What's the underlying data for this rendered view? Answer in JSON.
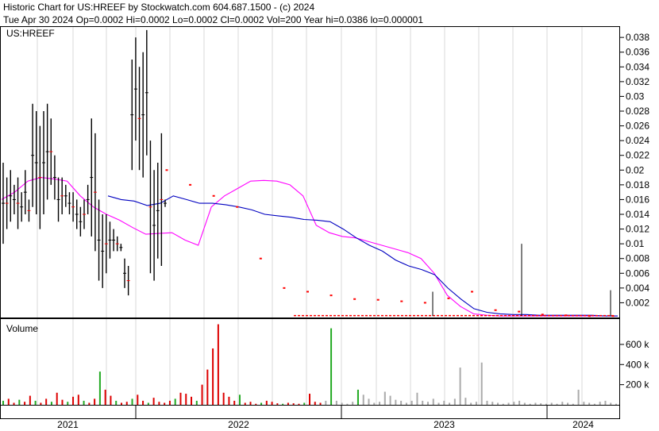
{
  "header": {
    "line1": "Historic Chart for US:HREEF by Stockwatch.com 604.687.1500 - (c) 2024",
    "line2": "Tue Apr 30 2024  Op=0.0002  Hi=0.0002  Lo=0.0002  Cl=0.0002  Vol=200  Year hi=0.0386  lo=0.000001"
  },
  "chart_data": [
    {
      "type": "line",
      "title": "US:HREEF",
      "ylim": [
        0,
        0.039
      ],
      "yticks": [
        "0.038",
        "0.036",
        "0.034",
        "0.032",
        "0.03",
        "0.028",
        "0.026",
        "0.024",
        "0.022",
        "0.02",
        "0.018",
        "0.016",
        "0.014",
        "0.012",
        "0.01",
        "0.008",
        "0.006",
        "0.004",
        "0.002"
      ],
      "xticks": [
        "2021",
        "2022",
        "2023",
        "2024"
      ],
      "grid": true,
      "colors": {
        "price": "#000000",
        "down_day": "#ff0000",
        "ma_short": "#ff00ff",
        "ma_long": "#0000c0"
      },
      "price_bars": [
        [
          0.01,
          0.021
        ],
        [
          0.012,
          0.019
        ],
        [
          0.013,
          0.02
        ],
        [
          0.014,
          0.018
        ],
        [
          0.012,
          0.019
        ],
        [
          0.013,
          0.017
        ],
        [
          0.014,
          0.02
        ],
        [
          0.013,
          0.016
        ],
        [
          0.015,
          0.029
        ],
        [
          0.014,
          0.028
        ],
        [
          0.012,
          0.026
        ],
        [
          0.014,
          0.028
        ],
        [
          0.016,
          0.029
        ],
        [
          0.018,
          0.027
        ],
        [
          0.016,
          0.022
        ],
        [
          0.013,
          0.019
        ],
        [
          0.014,
          0.019
        ],
        [
          0.015,
          0.018
        ],
        [
          0.014,
          0.017
        ],
        [
          0.013,
          0.017
        ],
        [
          0.012,
          0.016
        ],
        [
          0.011,
          0.015
        ],
        [
          0.012,
          0.016
        ],
        [
          0.014,
          0.018
        ],
        [
          0.011,
          0.027
        ],
        [
          0.009,
          0.025
        ],
        [
          0.005,
          0.016
        ],
        [
          0.004,
          0.014
        ],
        [
          0.006,
          0.014
        ],
        [
          0.008,
          0.013
        ],
        [
          0.009,
          0.012
        ],
        [
          0.009,
          0.011
        ],
        [
          0.009,
          0.01
        ],
        [
          0.004,
          0.008
        ],
        [
          0.003,
          0.007
        ],
        [
          0.02,
          0.035
        ],
        [
          0.024,
          0.038
        ],
        [
          0.02,
          0.034
        ],
        [
          0.019,
          0.036
        ],
        [
          0.022,
          0.039
        ],
        [
          0.006,
          0.024
        ],
        [
          0.005,
          0.02
        ],
        [
          0.008,
          0.021
        ],
        [
          0.007,
          0.025
        ],
        [
          0.015,
          0.016
        ]
      ],
      "dots": [
        [
          0.02
        ],
        [
          0.018
        ],
        [
          0.0165
        ],
        [
          0.015
        ],
        [
          0.008
        ],
        [
          0.004
        ],
        [
          0.0035
        ],
        [
          0.003
        ],
        [
          0.0025
        ],
        [
          0.0024
        ],
        [
          0.0022
        ],
        [
          0.002
        ],
        [
          0.0026
        ],
        [
          0.0035
        ],
        [
          0.001
        ],
        [
          0.0008
        ],
        [
          0.0004
        ],
        [
          0.0003
        ],
        [
          0.0002
        ],
        [
          0.0002
        ]
      ],
      "spikes": [
        {
          "date": "2023-05",
          "hi": 0.0035
        },
        {
          "date": "2023-11",
          "hi": 0.01
        },
        {
          "date": "2024-04",
          "hi": 0.0037
        }
      ],
      "ma_short": [
        0.016,
        0.017,
        0.0185,
        0.019,
        0.0188,
        0.0185,
        0.0165,
        0.015,
        0.014,
        0.0132,
        0.0122,
        0.0113,
        0.0114,
        0.0115,
        0.0105,
        0.0098,
        0.015,
        0.0165,
        0.0175,
        0.0185,
        0.0186,
        0.0185,
        0.018,
        0.0165,
        0.0125,
        0.0115,
        0.011,
        0.0108,
        0.0103,
        0.0098,
        0.0093,
        0.0088,
        0.008,
        0.006,
        0.003,
        0.0015,
        0.0005,
        0.0003,
        0.0002,
        0.0002,
        0.0002,
        0.0002,
        0.0002,
        0.0002,
        0.0002,
        0.0002,
        0.0002,
        0.0002
      ],
      "ma_long": [
        0.0165,
        0.016,
        0.0158,
        0.0152,
        0.0155,
        0.0165,
        0.016,
        0.0155,
        0.0155,
        0.0153,
        0.015,
        0.0146,
        0.014,
        0.0138,
        0.0136,
        0.0133,
        0.0132,
        0.013,
        0.012,
        0.0108,
        0.0098,
        0.009,
        0.0078,
        0.007,
        0.0065,
        0.0058,
        0.004,
        0.0025,
        0.0012,
        0.0007,
        0.0005,
        0.0004,
        0.0004,
        0.0003,
        0.0003,
        0.0003,
        0.0003,
        0.0003,
        0.0002,
        0.0002
      ]
    },
    {
      "type": "bar",
      "title": "Volume",
      "ylim": [
        0,
        800
      ],
      "yticks": [
        "600 k",
        "400 k",
        "200 k"
      ],
      "values_k": [
        40,
        60,
        20,
        50,
        30,
        90,
        40,
        20,
        60,
        30,
        120,
        50,
        30,
        80,
        100,
        40,
        20,
        60,
        330,
        150,
        90,
        40,
        20,
        30,
        60,
        100,
        40,
        20,
        70,
        30,
        20,
        40,
        60,
        120,
        110,
        80,
        40,
        200,
        350,
        560,
        800,
        120,
        80,
        40,
        100,
        20,
        30,
        10,
        20,
        40,
        30,
        15,
        10,
        20,
        15,
        10,
        20,
        110,
        30,
        20,
        40,
        760,
        40,
        20,
        10,
        30,
        150,
        100,
        60,
        20,
        30,
        130,
        90,
        50,
        40,
        20,
        40,
        120,
        40,
        30,
        60,
        20,
        40,
        20,
        60,
        370,
        70,
        20,
        30,
        420,
        40,
        30,
        20,
        10,
        20,
        30,
        40,
        20,
        10,
        20,
        15,
        10,
        20,
        10,
        30,
        20,
        10,
        150,
        30,
        20,
        10,
        30,
        40,
        20,
        10
      ]
    }
  ]
}
